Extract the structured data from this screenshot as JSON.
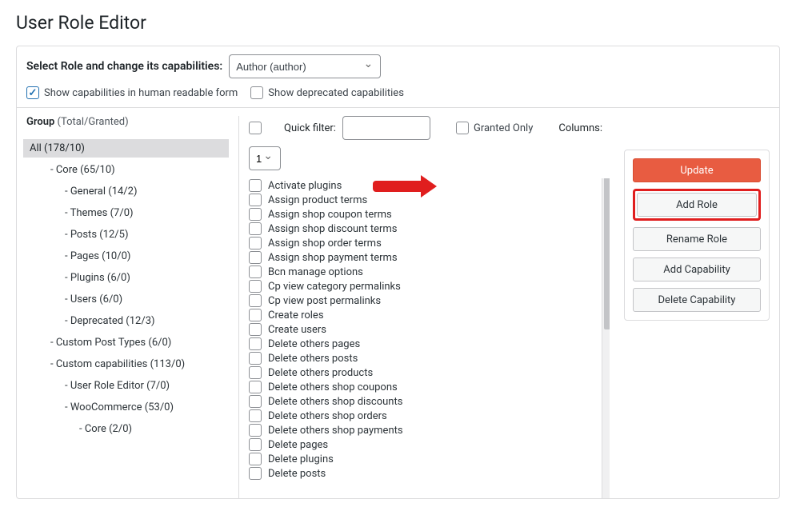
{
  "page_title": "User Role Editor",
  "select_role_label": "Select Role and change its capabilities:",
  "role_selected": "Author (author)",
  "human_readable_label": "Show capabilities in human readable form",
  "deprecated_label": "Show deprecated capabilities",
  "group_label": "Group",
  "group_suffix": " (Total/Granted)",
  "quick_filter_label": "Quick filter:",
  "granted_only_label": "Granted Only",
  "columns_label": "Columns:",
  "columns_value": "1",
  "groups": [
    {
      "label": "All (178/10)",
      "level": 0,
      "selected": true
    },
    {
      "label": "- Core (65/10)",
      "level": 1
    },
    {
      "label": "- General (14/2)",
      "level": 2
    },
    {
      "label": "- Themes (7/0)",
      "level": 2
    },
    {
      "label": "- Posts (12/5)",
      "level": 2
    },
    {
      "label": "- Pages (10/0)",
      "level": 2
    },
    {
      "label": "- Plugins (6/0)",
      "level": 2
    },
    {
      "label": "- Users (6/0)",
      "level": 2
    },
    {
      "label": "- Deprecated (12/3)",
      "level": 2
    },
    {
      "label": "- Custom Post Types (6/0)",
      "level": 1
    },
    {
      "label": "- Custom capabilities (113/0)",
      "level": 1
    },
    {
      "label": "- User Role Editor (7/0)",
      "level": 2
    },
    {
      "label": "- WooCommerce (53/0)",
      "level": 2
    },
    {
      "label": "- Core (2/0)",
      "level": 3
    }
  ],
  "capabilities": [
    "Activate plugins",
    "Assign product terms",
    "Assign shop coupon terms",
    "Assign shop discount terms",
    "Assign shop order terms",
    "Assign shop payment terms",
    "Bcn manage options",
    "Cp view category permalinks",
    "Cp view post permalinks",
    "Create roles",
    "Create users",
    "Delete others pages",
    "Delete others posts",
    "Delete others products",
    "Delete others shop coupons",
    "Delete others shop discounts",
    "Delete others shop orders",
    "Delete others shop payments",
    "Delete pages",
    "Delete plugins",
    "Delete posts"
  ],
  "actions": {
    "update": "Update",
    "add_role": "Add Role",
    "rename_role": "Rename Role",
    "add_capability": "Add Capability",
    "delete_capability": "Delete Capability"
  }
}
